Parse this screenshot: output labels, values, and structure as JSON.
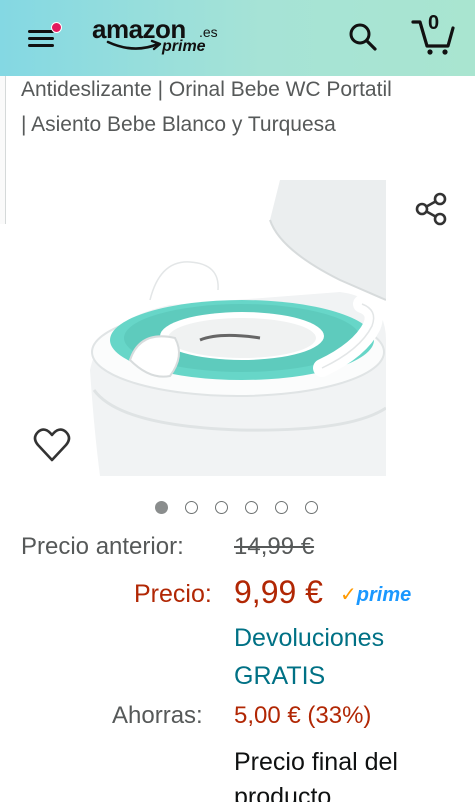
{
  "header": {
    "logo_text": "amazon",
    "logo_tld": ".es",
    "logo_prime": "prime",
    "cart_count": "0",
    "icons": {
      "menu": "hamburger-menu-icon",
      "notification": "notification-dot-icon",
      "search": "search-icon",
      "cart": "cart-icon"
    },
    "colors": {
      "gradient_start": "#84d8e3",
      "gradient_end": "#a9e5d0",
      "notification": "#e3195d"
    }
  },
  "product": {
    "title": "Antideslizante | Orinal Bebe WC Portatil | Asiento Bebe Blanco y Turquesa",
    "image_icon": "potty-seat-product-image",
    "share_icon": "share-icon",
    "wishlist_icon": "heart-icon",
    "carousel": {
      "count": 6,
      "active_index": 0
    }
  },
  "pricing": {
    "previous_label": "Precio anterior:",
    "previous_value": "14,99 €",
    "price_label": "Precio:",
    "price_value": "9,99 €",
    "prime_check": "✓",
    "prime_label": "prime",
    "returns_link": "Devoluciones GRATIS",
    "savings_label": "Ahorras:",
    "savings_value": "5,00 € (33%)",
    "final_price_text": "Precio final del producto",
    "colors": {
      "price": "#b12704",
      "link": "#007185",
      "prime": "#1a98ff",
      "muted": "#565959"
    }
  }
}
